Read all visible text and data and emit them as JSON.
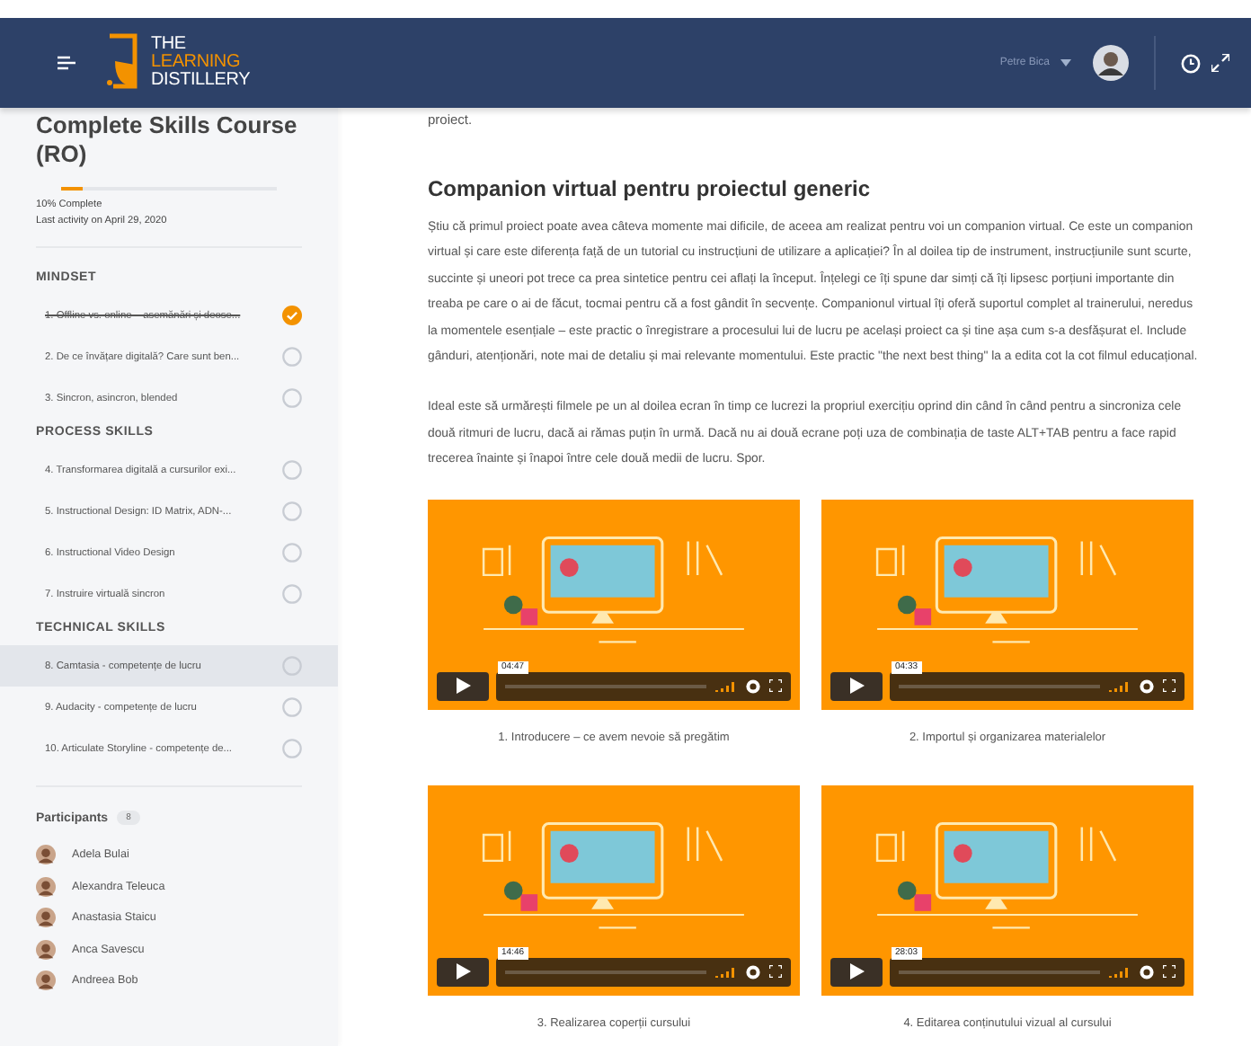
{
  "header": {
    "logo_lines": [
      "THE",
      "LEARNING",
      "DISTILLERY"
    ],
    "user_name": "Petre Bica"
  },
  "sidebar": {
    "course_title": "Complete Skills Course (RO)",
    "progress": {
      "level": 0.1,
      "label": "10% Complete",
      "last_activity": "Last activity on April 29, 2020"
    },
    "sections": [
      {
        "title": "MINDSET",
        "lessons": [
          {
            "label": "1. Offline vs. online – asemănări și deose...",
            "completed": true,
            "selected": false
          },
          {
            "label": "2. De ce învățare digitală? Care sunt ben...",
            "completed": false,
            "selected": false
          },
          {
            "label": "3. Sincron, asincron, blended",
            "completed": false,
            "selected": false
          }
        ]
      },
      {
        "title": "PROCESS SKILLS",
        "lessons": [
          {
            "label": "4. Transformarea digitală a cursurilor exi...",
            "completed": false,
            "selected": false
          },
          {
            "label": "5. Instructional Design: ID Matrix, ADN-...",
            "completed": false,
            "selected": false
          },
          {
            "label": "6. Instructional Video Design",
            "completed": false,
            "selected": false
          },
          {
            "label": "7. Instruire virtuală sincron",
            "completed": false,
            "selected": false
          }
        ]
      },
      {
        "title": "TECHNICAL SKILLS",
        "lessons": [
          {
            "label": "8. Camtasia - competențe de lucru",
            "completed": false,
            "selected": true
          },
          {
            "label": "9. Audacity - competențe de lucru",
            "completed": false,
            "selected": false
          },
          {
            "label": "10. Articulate Storyline - competențe de...",
            "completed": false,
            "selected": false
          }
        ]
      }
    ],
    "participants": {
      "title": "Participants",
      "count": "8",
      "people": [
        "Adela Bulai",
        "Alexandra Teleuca",
        "Anastasia Staicu",
        "Anca Savescu",
        "Andreea Bob"
      ]
    }
  },
  "main": {
    "lead_text": "proiect.",
    "heading": "Companion virtual pentru proiectul generic",
    "paragraphs": [
      "Știu că primul proiect poate avea câteva momente mai dificile, de aceea am realizat pentru voi un companion virtual. Ce este un companion virtual și care este diferența față de un tutorial cu instrucțiuni de utilizare a aplicației? În al doilea tip de instrument, instrucțiunile sunt scurte, succinte și uneori pot trece ca prea sintetice pentru cei aflați la început. Înțelegi ce îți spune dar simți că îți lipsesc porțiuni importante din treaba pe care o ai de făcut, tocmai pentru că a fost gândit în secvențe. Companionul virtual îți oferă suportul complet al trainerului, neredus la momentele esențiale – este practic o înregistrare a procesului lui de lucru pe același proiect ca și tine așa cum s-a desfășurat el. Include gânduri, atenționări, note mai de detaliu și mai relevante momentului. Este practic \"the next best thing\" la a edita cot la cot filmul educațional.",
      "Ideal este să urmărești filmele pe un al doilea ecran în timp ce lucrezi la propriul exercițiu oprind din când în când pentru a sincroniza cele două ritmuri de lucru, dacă ai rămas puțin în urmă. Dacă nu ai două ecrane poți uza de combinația de taste ALT+TAB pentru a face rapid trecerea înainte și înapoi între cele două medii de lucru. Spor."
    ],
    "videos": [
      {
        "duration": "04:47",
        "caption": "1. Introducere – ce avem nevoie să pregătim"
      },
      {
        "duration": "04:33",
        "caption": "2. Importul și organizarea materialelor"
      },
      {
        "duration": "14:46",
        "caption": "3. Realizarea coperții cursului"
      },
      {
        "duration": "28:03",
        "caption": "4. Editarea conținutului vizual al cursului"
      }
    ]
  }
}
